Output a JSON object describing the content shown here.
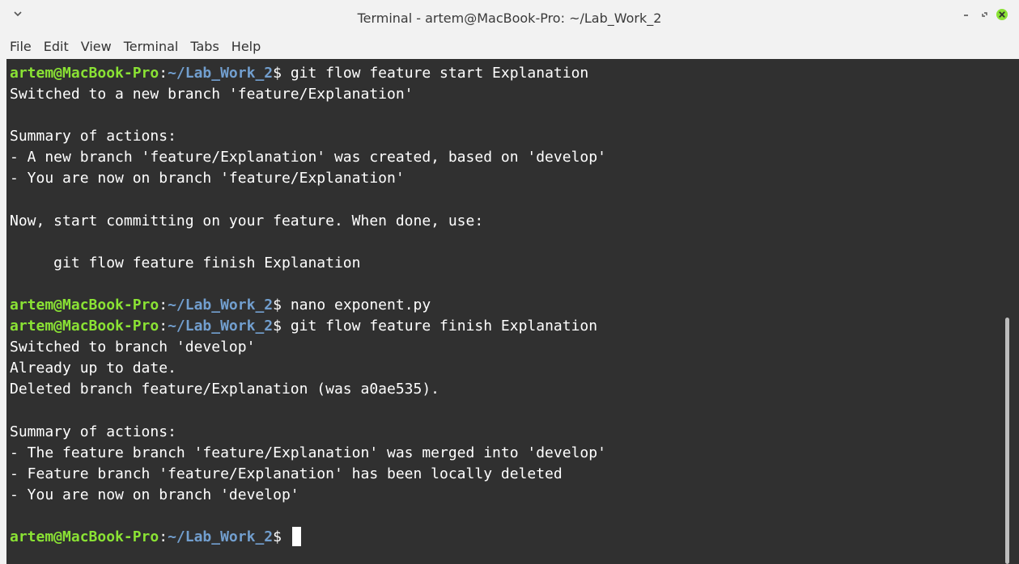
{
  "window": {
    "title": "Terminal - artem@MacBook-Pro: ~/Lab_Work_2",
    "menu_icon": "chevron-down-icon",
    "buttons": {
      "minimize": "minimize-icon",
      "maximize": "maximize-icon",
      "close": "close-icon",
      "close_color": "#8ae234"
    }
  },
  "menubar": {
    "items": [
      "File",
      "Edit",
      "View",
      "Terminal",
      "Tabs",
      "Help"
    ]
  },
  "terminal": {
    "colors": {
      "background": "#303030",
      "user": "#8ae234",
      "path": "#729fcf",
      "text": "#ffffff"
    },
    "prompt": {
      "user_host": "artem@MacBook-Pro",
      "colon": ":",
      "path": "~/Lab_Work_2",
      "symbol": "$"
    },
    "lines": [
      {
        "type": "prompt",
        "command": "git flow feature start Explanation"
      },
      {
        "type": "output",
        "text": "Switched to a new branch 'feature/Explanation'"
      },
      {
        "type": "output",
        "text": ""
      },
      {
        "type": "output",
        "text": "Summary of actions:"
      },
      {
        "type": "output",
        "text": "- A new branch 'feature/Explanation' was created, based on 'develop'"
      },
      {
        "type": "output",
        "text": "- You are now on branch 'feature/Explanation'"
      },
      {
        "type": "output",
        "text": ""
      },
      {
        "type": "output",
        "text": "Now, start committing on your feature. When done, use:"
      },
      {
        "type": "output",
        "text": ""
      },
      {
        "type": "output",
        "text": "     git flow feature finish Explanation"
      },
      {
        "type": "output",
        "text": ""
      },
      {
        "type": "prompt",
        "command": "nano exponent.py"
      },
      {
        "type": "prompt",
        "command": "git flow feature finish Explanation"
      },
      {
        "type": "output",
        "text": "Switched to branch 'develop'"
      },
      {
        "type": "output",
        "text": "Already up to date."
      },
      {
        "type": "output",
        "text": "Deleted branch feature/Explanation (was a0ae535)."
      },
      {
        "type": "output",
        "text": ""
      },
      {
        "type": "output",
        "text": "Summary of actions:"
      },
      {
        "type": "output",
        "text": "- The feature branch 'feature/Explanation' was merged into 'develop'"
      },
      {
        "type": "output",
        "text": "- Feature branch 'feature/Explanation' has been locally deleted"
      },
      {
        "type": "output",
        "text": "- You are now on branch 'develop'"
      },
      {
        "type": "output",
        "text": ""
      },
      {
        "type": "prompt",
        "command": "",
        "cursor": true
      }
    ]
  }
}
